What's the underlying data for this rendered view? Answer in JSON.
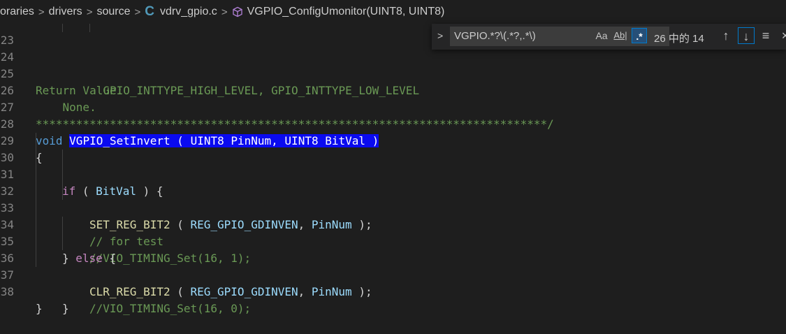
{
  "breadcrumb": {
    "items": [
      "oraries",
      "drivers",
      "source"
    ],
    "file_icon": "C",
    "file": "vdrv_gpio.c",
    "symbol": "VGPIO_ConfigUmonitor(UINT8, UINT8)",
    "separator": ">"
  },
  "find_widget": {
    "toggle_replace": ">",
    "query": "VGPIO.*?\\(.*?,.*\\)",
    "match_case_label": "Aa",
    "whole_word_label": "Ab|",
    "regex_label": ".*",
    "result_count": "26 中的 14",
    "prev_label": "↑",
    "next_label": "↓",
    "selection_label": "≡",
    "close_label": "×"
  },
  "editor": {
    "lines": [
      {
        "num": "23",
        "text": "          GPIO_INTTYPE_HIGH_LEVEL, GPIO_INTTYPE_LOW_LEVEL"
      },
      {
        "num": "24",
        "text": ""
      },
      {
        "num": "25",
        "text": "Return Value:"
      },
      {
        "num": "26",
        "text": "    None."
      },
      {
        "num": "27",
        "text": "****************************************************************************/"
      },
      {
        "num": "28",
        "text_parts": [
          "void",
          " ",
          "VGPIO_SetInvert ( UINT8 PinNum, UINT8 BitVal )"
        ]
      },
      {
        "num": "29",
        "text": "{"
      },
      {
        "num": "30",
        "text_parts": [
          "if",
          " ( ",
          "BitVal",
          " ) {"
        ]
      },
      {
        "num": "31",
        "text_parts": [
          "SET_REG_BIT2",
          " ( ",
          "REG_GPIO_GDINVEN",
          ", ",
          "PinNum",
          " );"
        ]
      },
      {
        "num": "32",
        "text": "// for test"
      },
      {
        "num": "33",
        "text": "//VIO_TIMING_Set(16, 1);"
      },
      {
        "num": "34",
        "text_parts": [
          "} ",
          "else",
          " {"
        ]
      },
      {
        "num": "35",
        "text_parts": [
          "CLR_REG_BIT2",
          " ( ",
          "REG_GPIO_GDINVEN",
          ", ",
          "PinNum",
          " );"
        ]
      },
      {
        "num": "36",
        "text": "//VIO_TIMING_Set(16, 0);"
      },
      {
        "num": "37",
        "text": "}"
      },
      {
        "num": "38",
        "text": "}"
      }
    ]
  },
  "colors": {
    "background": "#1e1e1e",
    "comment": "#6a9955",
    "keyword": "#569cd6",
    "control": "#c586c0",
    "function": "#dcdcaa",
    "variable": "#9cdcfe",
    "highlight": "#0a0af0",
    "c_icon": "#519aba"
  },
  "icons": {
    "file_icon": "c-language-icon",
    "symbol_icon": "cube-method-icon"
  }
}
